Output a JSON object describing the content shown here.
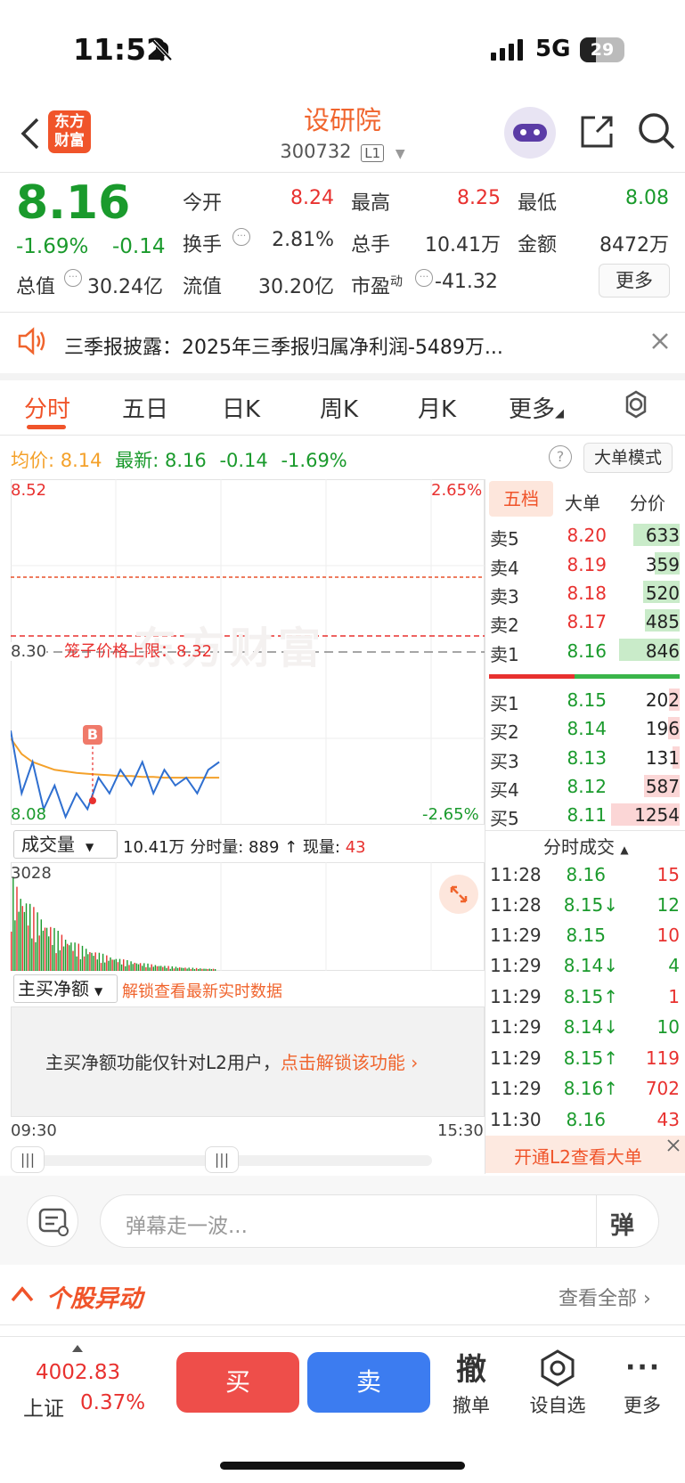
{
  "status": {
    "time": "11:52",
    "network": "5G",
    "battery": "29"
  },
  "header": {
    "logo_line1": "东方",
    "logo_line2": "财富",
    "title": "设研院",
    "code": "300732",
    "level": "L1"
  },
  "quote": {
    "price": "8.16",
    "change_pct": "-1.69%",
    "change": "-0.14",
    "open_label": "今开",
    "open": "8.24",
    "high_label": "最高",
    "high": "8.25",
    "low_label": "最低",
    "low": "8.08",
    "turnover_label": "换手",
    "turnover": "2.81%",
    "volume_label": "总手",
    "volume": "10.41万",
    "amount_label": "金额",
    "amount": "8472万",
    "mktcap_label": "总值",
    "mktcap": "30.24亿",
    "float_label": "流值",
    "float": "30.20亿",
    "pe_label": "市盈",
    "pe_sup": "动",
    "pe": "-41.32",
    "more_label": "更多"
  },
  "notice": {
    "text": "三季报披露：2025年三季报归属净利润-5489万..."
  },
  "tabs": [
    "分时",
    "五日",
    "日K",
    "周K",
    "月K",
    "更多"
  ],
  "info_bar": {
    "avg_label": "均价:",
    "avg": "8.14",
    "latest_label": "最新:",
    "latest": "8.16",
    "chg": "-0.14",
    "chg_pct": "-1.69%",
    "mode_label": "大单模式"
  },
  "chart": {
    "price_top": "8.52",
    "pct_top": "2.65%",
    "price_mid": "8.30",
    "price_bottom": "8.08",
    "pct_bottom": "-2.65%",
    "limit_label": "笼子价格上限：8.32",
    "buy_marker": "B",
    "watermark": "东方财富",
    "vol_header_label": "成交量",
    "vol_header_value": "10.41万",
    "vol_header_mid": "分时量: 889 ↑ 现量:",
    "vol_header_now": "43",
    "vol_max": "3028",
    "net_label": "主买净额",
    "net_unlock": "解锁查看最新实时数据",
    "net_notice": "主买净额功能仅针对L2用户，",
    "net_link": "点击解锁该功能",
    "time_start": "09:30",
    "time_end": "15:30"
  },
  "chart_data": {
    "type": "line",
    "series": [
      {
        "name": "均价",
        "values": [
          8.19,
          8.17,
          8.16,
          8.155,
          8.15,
          8.148,
          8.146,
          8.145,
          8.144,
          8.143,
          8.142,
          8.142,
          8.141,
          8.141,
          8.14,
          8.14,
          8.14,
          8.14,
          8.14,
          8.14
        ]
      },
      {
        "name": "最新",
        "values": [
          8.2,
          8.12,
          8.16,
          8.1,
          8.13,
          8.09,
          8.12,
          8.1,
          8.14,
          8.12,
          8.15,
          8.13,
          8.16,
          8.12,
          8.15,
          8.13,
          8.14,
          8.12,
          8.15,
          8.16
        ]
      }
    ],
    "ylim": [
      8.08,
      8.52
    ]
  },
  "orderbook": {
    "tabs": [
      "五档",
      "大单",
      "分价"
    ],
    "asks": [
      {
        "label": "卖5",
        "price": "8.20",
        "vol": "633"
      },
      {
        "label": "卖4",
        "price": "8.19",
        "vol": "359"
      },
      {
        "label": "卖3",
        "price": "8.18",
        "vol": "520"
      },
      {
        "label": "卖2",
        "price": "8.17",
        "vol": "485"
      },
      {
        "label": "卖1",
        "price": "8.16",
        "vol": "846"
      }
    ],
    "bids": [
      {
        "label": "买1",
        "price": "8.15",
        "vol": "202"
      },
      {
        "label": "买2",
        "price": "8.14",
        "vol": "196"
      },
      {
        "label": "买3",
        "price": "8.13",
        "vol": "131"
      },
      {
        "label": "买4",
        "price": "8.12",
        "vol": "587"
      },
      {
        "label": "买5",
        "price": "8.11",
        "vol": "1254"
      }
    ],
    "ticks_title": "分时成交",
    "ticks": [
      {
        "t": "11:28",
        "p": "8.16",
        "v": "15"
      },
      {
        "t": "11:28",
        "p": "8.15↓",
        "v": "12"
      },
      {
        "t": "11:29",
        "p": "8.15",
        "v": "10"
      },
      {
        "t": "11:29",
        "p": "8.14↓",
        "v": "4"
      },
      {
        "t": "11:29",
        "p": "8.15↑",
        "v": "1"
      },
      {
        "t": "11:29",
        "p": "8.14↓",
        "v": "10"
      },
      {
        "t": "11:29",
        "p": "8.15↑",
        "v": "119"
      },
      {
        "t": "11:29",
        "p": "8.16↑",
        "v": "702"
      },
      {
        "t": "11:30",
        "p": "8.16",
        "v": "43"
      }
    ],
    "l2_banner": "开通L2查看大单"
  },
  "danmaku": {
    "placeholder": "弹幕走一波...",
    "send_label": "弹"
  },
  "movement": {
    "title": "个股异动",
    "view_all": "查看全部"
  },
  "bottom": {
    "index_value": "4002.83",
    "index_name": "上证",
    "index_pct": "0.37%",
    "buy": "买",
    "sell": "卖",
    "cancel_icon": "撤",
    "cancel_label": "撤单",
    "fav_label": "设自选",
    "more_label": "更多"
  }
}
